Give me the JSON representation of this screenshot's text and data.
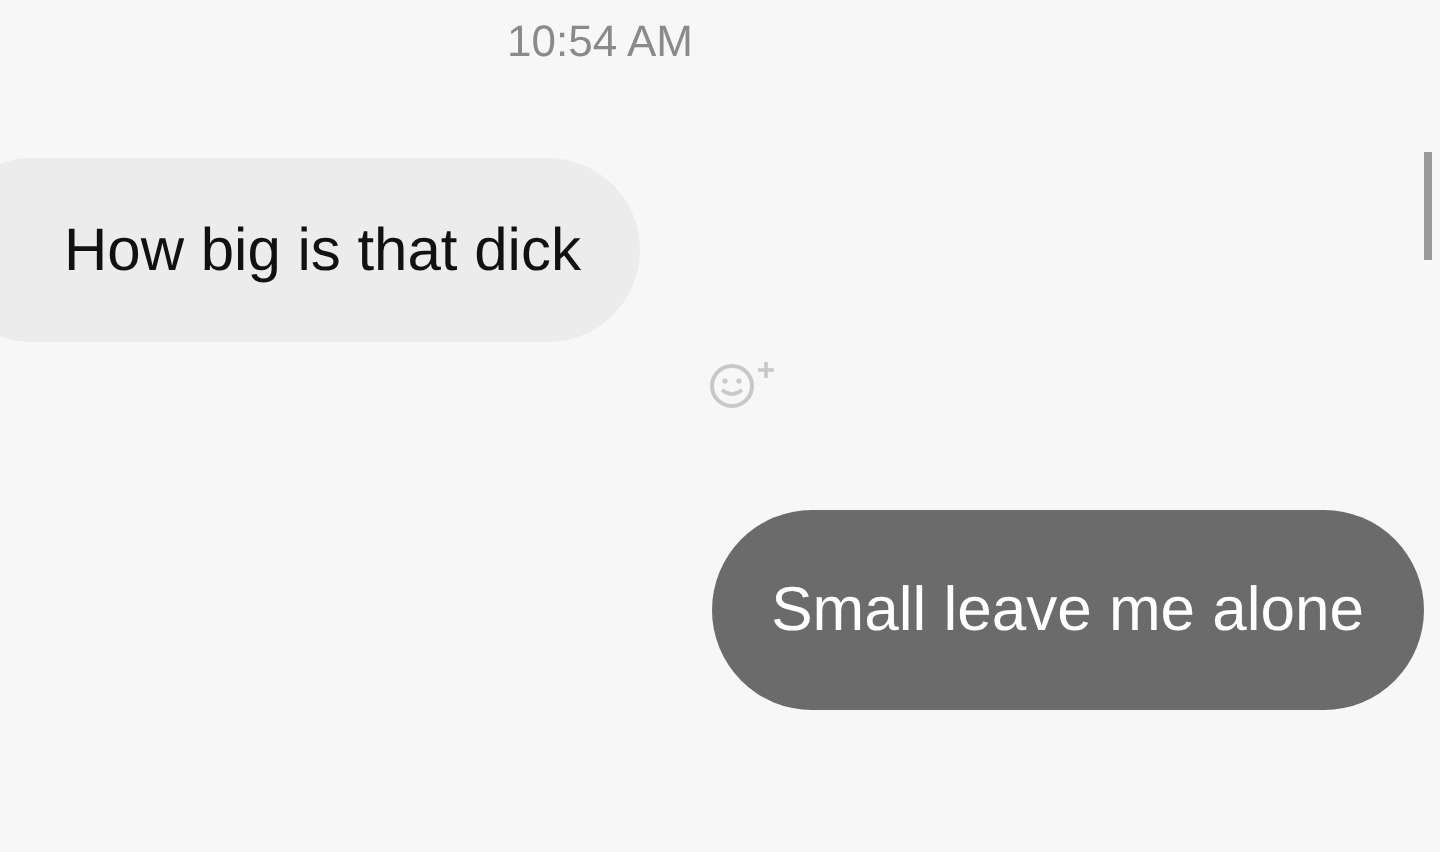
{
  "timestamp": "10:54 AM",
  "messages": [
    {
      "kind": "incoming",
      "text": "How big is that dick"
    },
    {
      "kind": "outgoing",
      "text": "Small leave me alone"
    }
  ]
}
